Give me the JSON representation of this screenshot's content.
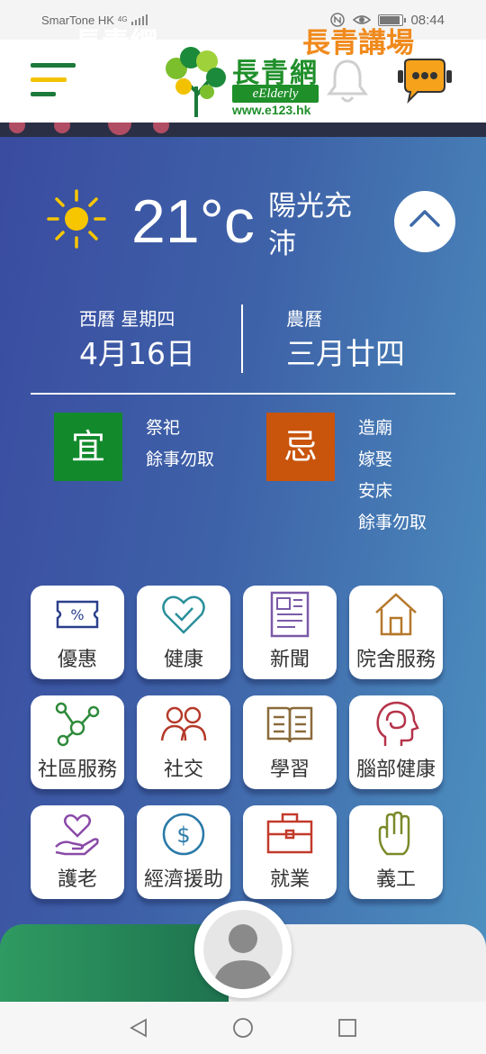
{
  "status_bar": {
    "carrier": "SmarTone HK",
    "network": "4G",
    "time": "08:44"
  },
  "header": {
    "logo_title": "長青網",
    "logo_sub": "eElderly",
    "logo_url": "www.e123.hk",
    "icons": [
      "menu-icon",
      "bell-icon",
      "chatbot-icon"
    ]
  },
  "weather": {
    "icon": "sun-icon",
    "temperature": "21°c",
    "condition": "陽光充沛"
  },
  "calendar": {
    "western_label": "西曆 星期四",
    "western_date": "4月16日",
    "lunar_label": "農曆",
    "lunar_date": "三月廿四"
  },
  "almanac": {
    "good": {
      "label": "宜",
      "color": "#128a2c",
      "items": [
        "祭祀",
        "餘事勿取"
      ]
    },
    "bad": {
      "label": "忌",
      "color": "#c9540c",
      "items": [
        "造廟",
        "嫁娶",
        "安床",
        "餘事勿取"
      ]
    }
  },
  "services": [
    {
      "label": "優惠",
      "icon": "coupon-icon"
    },
    {
      "label": "健康",
      "icon": "heart-check-icon"
    },
    {
      "label": "新聞",
      "icon": "newspaper-icon"
    },
    {
      "label": "院舍服務",
      "icon": "house-icon"
    },
    {
      "label": "社區服務",
      "icon": "network-icon"
    },
    {
      "label": "社交",
      "icon": "people-icon"
    },
    {
      "label": "學習",
      "icon": "book-icon"
    },
    {
      "label": "腦部健康",
      "icon": "brain-head-icon"
    },
    {
      "label": "護老",
      "icon": "hand-heart-icon"
    },
    {
      "label": "經濟援助",
      "icon": "dollar-icon"
    },
    {
      "label": "就業",
      "icon": "briefcase-icon"
    },
    {
      "label": "義工",
      "icon": "raised-hand-icon"
    }
  ],
  "bottom_tabs": {
    "left": "長青網",
    "right": "長青講場"
  },
  "colors": {
    "brand_green": "#1f8f2a",
    "accent_orange": "#f08a1c",
    "gradient_start": "#3a4ba0",
    "gradient_end": "#4d92c0"
  }
}
